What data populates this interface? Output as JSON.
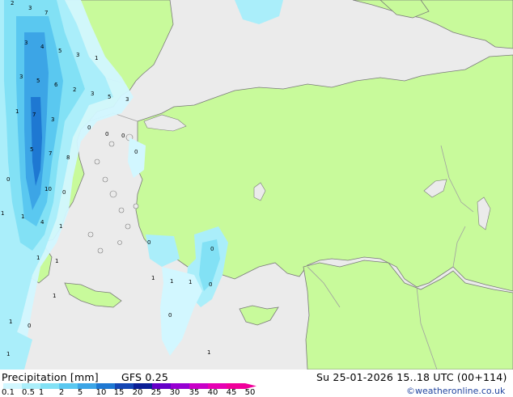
{
  "header": {
    "product": "Precipitation [mm]",
    "model": "GFS 0.25",
    "valid_time": "Su 25-01-2026 15..18 UTC (00+114)",
    "credit": "©weatheronline.co.uk"
  },
  "legend": {
    "ticks": [
      "0.1",
      "0.5",
      "1",
      "2",
      "5",
      "10",
      "15",
      "20",
      "25",
      "30",
      "35",
      "40",
      "45",
      "50"
    ],
    "colors": [
      "#d2f7ff",
      "#aaeefa",
      "#82e1f5",
      "#5ac8f0",
      "#3ca5e6",
      "#1e78d2",
      "#1446b4",
      "#0a1e96",
      "#6400c8",
      "#9600d2",
      "#c800c8",
      "#e600b4",
      "#f0009b"
    ]
  },
  "map": {
    "colors": {
      "sea": "#ebebeb",
      "land": "#c8fa9b",
      "border": "#a0a0a0",
      "coast": "#7a7a7a"
    },
    "grid_values": [
      "2",
      "3",
      "7",
      "3",
      "4",
      "5",
      "3",
      "1",
      "3",
      "5",
      "6",
      "2",
      "3",
      "5",
      "3",
      "1",
      "7",
      "3",
      "5",
      "7",
      "8",
      "10",
      "1",
      "4",
      "1",
      "1",
      "1",
      "1",
      "1",
      "1",
      "0",
      "0",
      "0",
      "0",
      "0",
      "0",
      "0",
      "1",
      "1",
      "1",
      "0",
      "0",
      "0",
      "1",
      "0",
      "1"
    ]
  }
}
